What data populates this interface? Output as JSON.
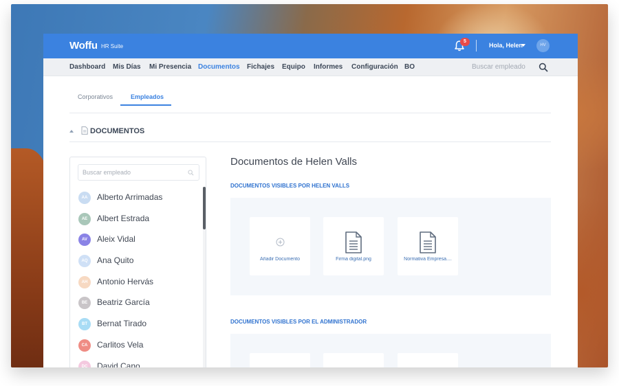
{
  "header": {
    "logo": "Woffu",
    "logo_sub": "HR Suite",
    "notifications_count": "5",
    "greeting": "Hola, Helen",
    "avatar_initials": "HV",
    "colors": {
      "brand": "#3b82e0",
      "badge": "#e84a4a"
    }
  },
  "nav": {
    "items": [
      {
        "label": "Dashboard"
      },
      {
        "label": "Mis Días"
      },
      {
        "label": "Mi Presencia"
      },
      {
        "label": "Documentos",
        "active": true
      },
      {
        "label": "Fichajes"
      },
      {
        "label": "Equipo"
      },
      {
        "label": "Informes"
      },
      {
        "label": "Configuración"
      },
      {
        "label": "BO"
      }
    ],
    "search_placeholder": "Buscar empleado",
    "search_icon": "search-icon"
  },
  "subtabs": {
    "items": [
      {
        "label": "Corporativos"
      },
      {
        "label": "Empleados",
        "active": true
      }
    ]
  },
  "section": {
    "title": "DOCUMENTOS",
    "icon": "document-icon"
  },
  "employees": {
    "search_placeholder": "Buscar empleado",
    "list": [
      {
        "name": "Alberto Arrimadas",
        "initials": "AA",
        "color": "#c9dcf2"
      },
      {
        "name": "Albert Estrada",
        "initials": "AE",
        "color": "#a9c7b9"
      },
      {
        "name": "Aleix Vidal",
        "initials": "AV",
        "color": "#8a83e6"
      },
      {
        "name": "Ana Quito",
        "initials": "AQ",
        "color": "#cfe0f6"
      },
      {
        "name": "Antonio Hervás",
        "initials": "AH",
        "color": "#f7d9c2"
      },
      {
        "name": "Beatriz García",
        "initials": "BE",
        "color": "#c9c5c8"
      },
      {
        "name": "Bernat Tirado",
        "initials": "BT",
        "color": "#a8dcf5"
      },
      {
        "name": "Carlitos Vela",
        "initials": "CA",
        "color": "#ef8c84"
      },
      {
        "name": "David Cano",
        "initials": "DC",
        "color": "#f4c9df"
      }
    ]
  },
  "documents": {
    "title": "Documentos de Helen Valls",
    "visible_by_employee_label": "DOCUMENTOS VISIBLES POR HELEN VALLS",
    "visible_by_admin_label": "DOCUMENTOS VISIBLES POR EL ADMINISTRADOR",
    "add_label": "Añadir Documento",
    "files": [
      {
        "name": "Firma digital.png",
        "icon": "file-icon"
      },
      {
        "name": "Normativa Empresa....",
        "icon": "file-icon"
      }
    ]
  }
}
